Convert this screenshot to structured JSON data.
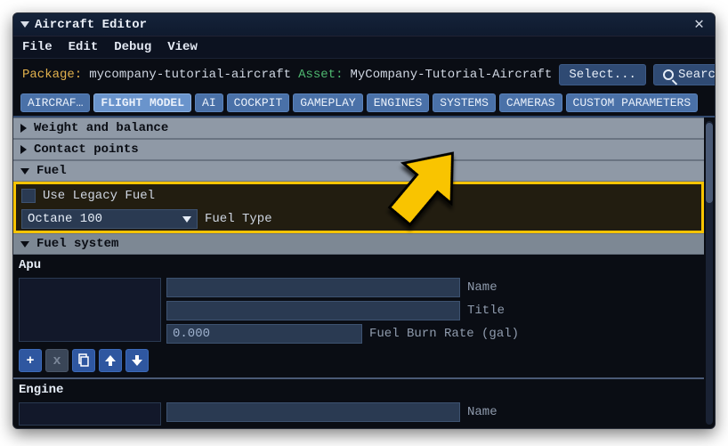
{
  "window": {
    "title": "Aircraft Editor"
  },
  "menu": {
    "file": "File",
    "edit": "Edit",
    "debug": "Debug",
    "view": "View"
  },
  "info": {
    "pkg_label": "Package:",
    "pkg_value": "mycompany-tutorial-aircraft",
    "asset_label": "Asset:",
    "asset_value": "MyCompany-Tutorial-Aircraft",
    "select_btn": "Select...",
    "search_btn": "Search"
  },
  "tabs": [
    "AIRCRAF…",
    "FLIGHT MODEL",
    "AI",
    "COCKPIT",
    "GAMEPLAY",
    "ENGINES",
    "SYSTEMS",
    "CAMERAS",
    "CUSTOM PARAMETERS"
  ],
  "active_tab": 1,
  "sections": {
    "weight": "Weight and balance",
    "contact": "Contact points",
    "fuel": "Fuel",
    "fuel_system": "Fuel system"
  },
  "fuel": {
    "use_legacy_label": "Use Legacy Fuel",
    "fuel_type_value": "Octane 100",
    "fuel_type_label": "Fuel Type"
  },
  "fuel_system": {
    "apu_heading": "Apu",
    "engine_heading": "Engine",
    "fields": {
      "name": {
        "label": "Name",
        "value": ""
      },
      "title": {
        "label": "Title",
        "value": ""
      },
      "burn": {
        "label": "Fuel Burn Rate (gal)",
        "value": "0.000"
      },
      "engine_name": {
        "label": "Name",
        "value": ""
      }
    }
  },
  "icons": {
    "plus": "+",
    "times": "x"
  }
}
